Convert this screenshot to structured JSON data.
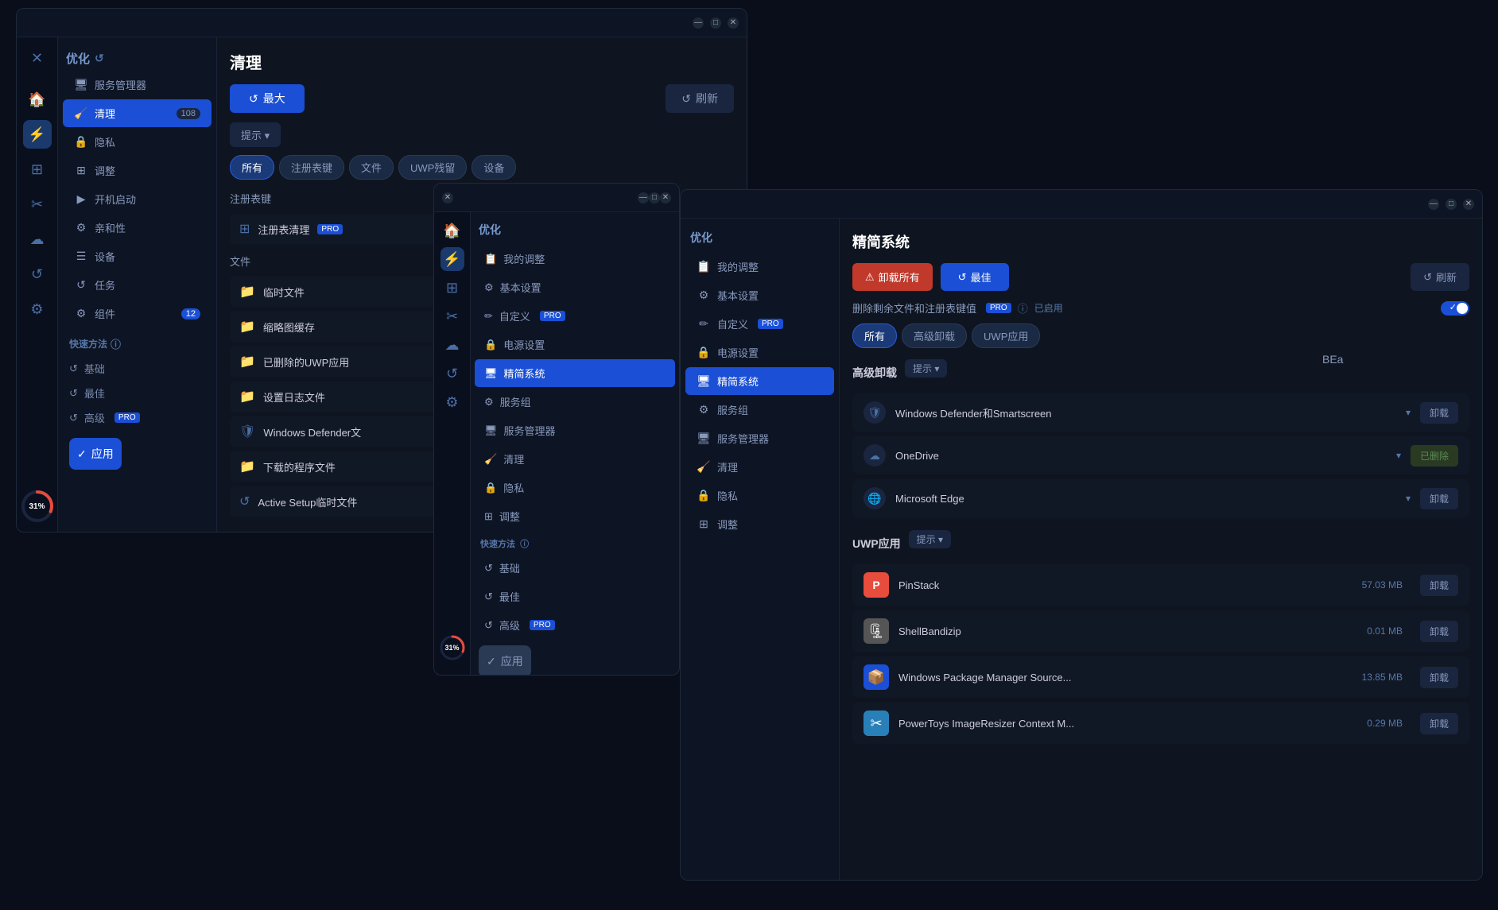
{
  "app": {
    "title": "优化",
    "icon": "⚡"
  },
  "window_main": {
    "title": "优化",
    "main_section": "清理",
    "btn_max": "最大",
    "btn_refresh": "刷新",
    "btn_hint": "提示",
    "filter_tabs": [
      "所有",
      "注册表键",
      "文件",
      "UWP残留",
      "设备"
    ],
    "section_registry": "注册表键",
    "registry_item": "注册表清理",
    "section_files": "文件",
    "file_items": [
      "临时文件",
      "缩略图缓存",
      "已删除的UWP应用",
      "设置日志文件",
      "Windows Defender文",
      "下载的程序文件",
      "Active Setup临时文件"
    ],
    "apply_btn": "应用",
    "nav_items": [
      {
        "label": "服务管理器",
        "icon": "🖥"
      },
      {
        "label": "清理",
        "icon": "🧹",
        "active": true
      },
      {
        "label": "隐私",
        "icon": "🔒"
      },
      {
        "label": "调整",
        "icon": "⊞"
      },
      {
        "label": "开机启动",
        "icon": "▶"
      },
      {
        "label": "亲和性",
        "icon": "⚙"
      },
      {
        "label": "设备",
        "icon": "☰"
      },
      {
        "label": "任务",
        "icon": "↺"
      },
      {
        "label": "组件",
        "icon": "⚙",
        "badge": "12"
      }
    ],
    "quick_methods": {
      "title": "快速方法",
      "items": [
        "基础",
        "最佳",
        "高级"
      ]
    },
    "badge_108": "108"
  },
  "window_mid": {
    "nav_items": [
      {
        "label": "我的调整",
        "icon": "📋"
      },
      {
        "label": "基本设置",
        "icon": "⚙"
      },
      {
        "label": "自定义",
        "icon": "✏",
        "pro": true
      },
      {
        "label": "电源设置",
        "icon": "🔒"
      },
      {
        "label": "精简系统",
        "icon": "🖥",
        "active": true
      },
      {
        "label": "服务组",
        "icon": "⚙"
      },
      {
        "label": "服务管理器",
        "icon": "🖥"
      },
      {
        "label": "清理",
        "icon": "🧹"
      },
      {
        "label": "隐私",
        "icon": "🔒"
      },
      {
        "label": "调整",
        "icon": "⊞"
      }
    ],
    "quick_methods": {
      "title": "快速方法",
      "items": [
        "基础",
        "最佳",
        "高级"
      ]
    },
    "apply_btn": "应用",
    "progress_pct": "31%"
  },
  "window_right": {
    "title": "精简系统",
    "btn_unload_all": "卸载所有",
    "btn_best": "最佳",
    "btn_refresh": "刷新",
    "info_text": "删除剩余文件和注册表键值",
    "info_badge": "PRO",
    "toggle_label": "已启用",
    "filter_tabs": [
      "所有",
      "高级卸载",
      "UWP应用"
    ],
    "advanced_section": "高级卸载",
    "hint_btn": "提示",
    "uwp_section": "UWP应用",
    "hint_btn2": "提示",
    "expand_items": [
      {
        "name": "Windows Defender和Smartscreen",
        "icon": "🛡",
        "btn": "卸载"
      },
      {
        "name": "OneDrive",
        "icon": "☁",
        "btn": "已删除"
      },
      {
        "name": "Microsoft Edge",
        "icon": "🌐",
        "btn": "卸载"
      }
    ],
    "app_items": [
      {
        "name": "PinStack",
        "icon": "P",
        "icon_color": "#e74c3c",
        "size": "57.03 MB",
        "btn": "卸载"
      },
      {
        "name": "ShellBandizip",
        "icon": "🗜",
        "icon_color": "#888",
        "size": "0.01 MB",
        "btn": "卸载"
      },
      {
        "name": "Windows Package Manager Source...",
        "icon": "📦",
        "icon_color": "#3498db",
        "size": "13.85 MB",
        "btn": "卸载"
      },
      {
        "name": "PowerToys ImageResizer Context M...",
        "icon": "✂",
        "icon_color": "#2980b9",
        "size": "0.29 MB",
        "btn": "卸载"
      }
    ],
    "nav_items": [
      {
        "label": "我的调整",
        "icon": "📋"
      },
      {
        "label": "基本设置",
        "icon": "⚙"
      },
      {
        "label": "自定义",
        "icon": "✏",
        "pro": true
      },
      {
        "label": "电源设置",
        "icon": "🔒"
      },
      {
        "label": "精简系统",
        "icon": "🖥",
        "active": true
      },
      {
        "label": "服务组",
        "icon": "⚙"
      },
      {
        "label": "服务管理器",
        "icon": "🖥"
      },
      {
        "label": "清理",
        "icon": "🧹"
      },
      {
        "label": "隐私",
        "icon": "🔒"
      },
      {
        "label": "调整",
        "icon": "⊞"
      }
    ]
  },
  "bea_text": "BEa",
  "progress_pct": "31%"
}
